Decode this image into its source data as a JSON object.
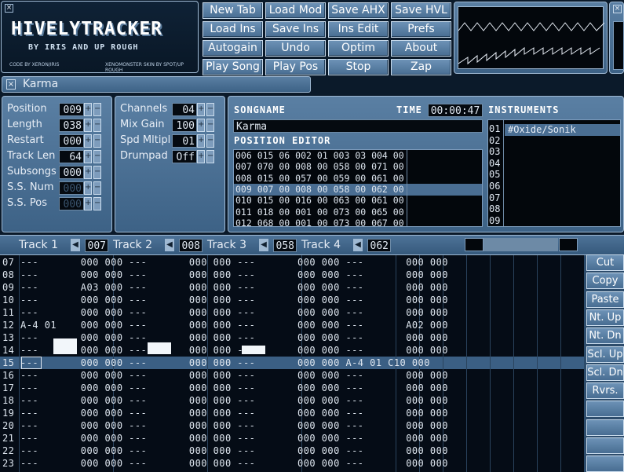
{
  "logo": {
    "title": "HIVELYTRACKER",
    "subtitle": "BY IRIS AND UP ROUGH",
    "credit_left": "CODE BY XERON/IRIS",
    "credit_right": "XENOMONSTER SKIN BY SPOT/UP ROUGH"
  },
  "toolbar": {
    "buttons": [
      [
        "New Tab",
        "Load Mod",
        "Save AHX",
        "Save HVL"
      ],
      [
        "Load Ins",
        "Save Ins",
        "Ins Edit",
        "Prefs"
      ],
      [
        "Autogain",
        "Undo",
        "Optim",
        "About"
      ],
      [
        "Play Song",
        "Play Pos",
        "Stop",
        "Zap"
      ]
    ]
  },
  "tab": {
    "close": "×",
    "title": "Karma"
  },
  "song": {
    "rows": [
      {
        "label": "Position",
        "value": "009"
      },
      {
        "label": "Length",
        "value": "038"
      },
      {
        "label": "Restart",
        "value": "000"
      },
      {
        "label": "Track Len",
        "value": "64"
      },
      {
        "label": "Subsongs",
        "value": "000"
      },
      {
        "label": "S.S. Num",
        "value": "000"
      },
      {
        "label": "S.S. Pos",
        "value": "000"
      }
    ]
  },
  "mix": {
    "rows": [
      {
        "label": "Channels",
        "value": "04"
      },
      {
        "label": "Mix Gain",
        "value": "100"
      },
      {
        "label": "Spd Mltipl",
        "value": "01"
      },
      {
        "label": "Drumpad",
        "value": "Off"
      }
    ]
  },
  "songname": {
    "header": "SONGNAME",
    "value": "Karma",
    "time_label": "TIME",
    "time": "00:00:47"
  },
  "poseditor": {
    "header": "POSITION EDITOR",
    "rows": [
      "006 015 06 002 01 003 03 004 00",
      "007 070 00 008 00 058 00 071 00",
      "008 015 00 057 00 059 00 061 00",
      "009 007 00 008 00 058 00 062 00",
      "010 015 00 016 00 063 00 061 00",
      "011 018 00 001 00 073 00 065 00",
      "012 068 00 001 00 073 00 067 00"
    ],
    "active_row": 3
  },
  "instruments": {
    "header": "INSTRUMENTS",
    "numbers": [
      "01",
      "02",
      "03",
      "04",
      "05",
      "06",
      "07",
      "08",
      "09"
    ],
    "first": "#Oxide/Sonik"
  },
  "tracks": [
    {
      "label": "Track 1",
      "value": "007"
    },
    {
      "label": "Track 2",
      "value": "008"
    },
    {
      "label": "Track 3",
      "value": "058"
    },
    {
      "label": "Track 4",
      "value": "062"
    }
  ],
  "pattern": {
    "lines": [
      "07 ---       000 000 ---       000 000 ---       000 000 ---       000 000",
      "08 ---       000 000 ---       000 000 ---       000 000 ---       000 000",
      "09 ---       A03 000 ---       000 000 ---       000 000 ---       000 000",
      "10 ---       000 000 ---       000 000 ---       000 000 ---       000 000",
      "11 ---       000 000 ---       000 000 ---       000 000 ---       000 000",
      "12 A-4 01    000 000 ---       000 000 ---       000 000 ---       A02 000",
      "13 ---       000 000 ---       000 000 ---       000 000 ---       000 000",
      "14 ---       000 000 ---       000 000 ---       000 000 ---       000 000",
      "15 ---       000 000 ---       000 000 ---       000 000 A-4 01 C10 000",
      "16 ---       000 000 ---       000 000 ---       000 000 ---       000 000",
      "17 ---       000 000 ---       000 000 ---       000 000 ---       000 000",
      "18 ---       000 000 ---       000 000 ---       000 000 ---       000 000",
      "19 ---       000 000 ---       000 000 ---       000 000 ---       000 000",
      "20 ---       000 000 ---       000 000 ---       000 000 ---       000 000",
      "21 ---       000 000 ---       000 000 ---       000 000 ---       000 000",
      "22 ---       000 000 ---       000 000 ---       000 000 ---       000 000",
      "23 ---       000 000 ---       000 000 ---       000 000 ---       000 000"
    ],
    "cursor_row": 8
  },
  "side": {
    "buttons": [
      "Cut",
      "Copy",
      "Paste",
      "Nt. Up",
      "Nt. Dn",
      "Scl. Up",
      "Scl. Dn",
      "Rvrs.",
      "",
      "",
      "",
      ""
    ]
  }
}
